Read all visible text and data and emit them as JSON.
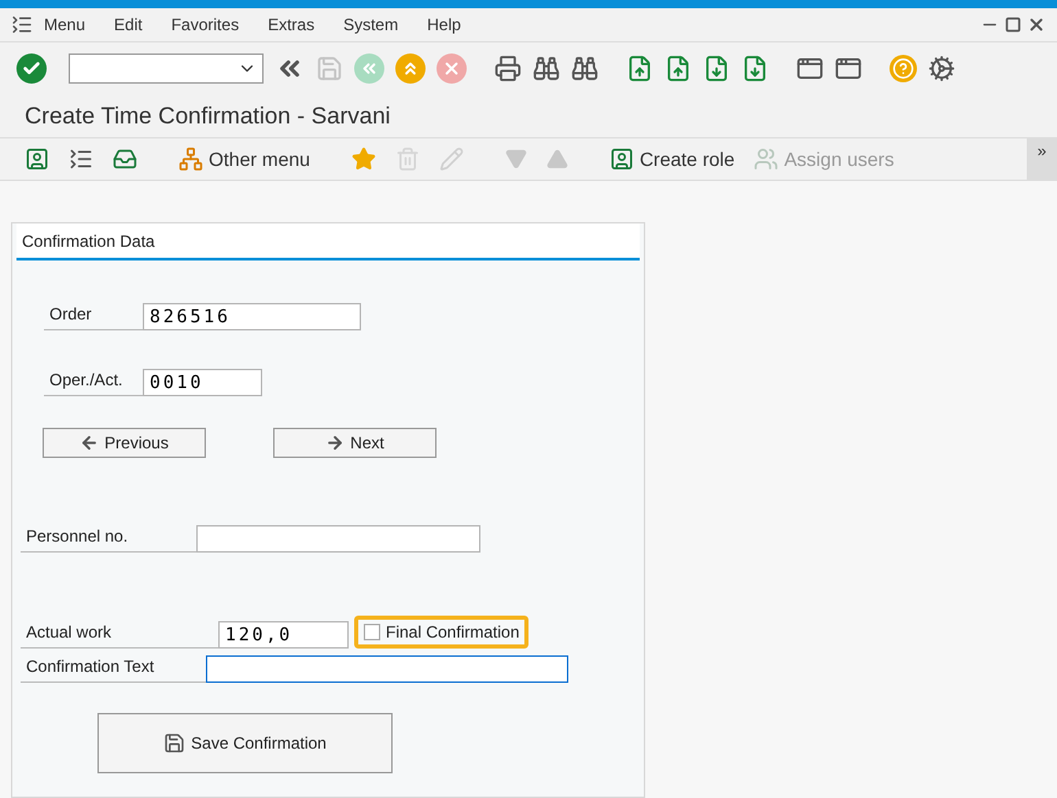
{
  "menu_bar": {
    "items": [
      "Menu",
      "Edit",
      "Favorites",
      "Extras",
      "System",
      "Help"
    ]
  },
  "toolbar": {
    "buttons": [
      {
        "kind": "enter",
        "disabled": false
      },
      {
        "kind": "collapse",
        "disabled": false
      },
      {
        "kind": "save",
        "disabled": true
      },
      {
        "kind": "back",
        "disabled": true
      },
      {
        "kind": "exit",
        "disabled": false
      },
      {
        "kind": "cancel",
        "disabled": true
      },
      {
        "kind": "print",
        "disabled": false
      },
      {
        "kind": "find",
        "disabled": false
      },
      {
        "kind": "find-next",
        "disabled": false
      },
      {
        "kind": "first-page",
        "disabled": false
      },
      {
        "kind": "previous-page",
        "disabled": false
      },
      {
        "kind": "next-page",
        "disabled": false
      },
      {
        "kind": "last-page",
        "disabled": false
      },
      {
        "kind": "new-session",
        "disabled": false
      },
      {
        "kind": "shortcut",
        "disabled": false
      },
      {
        "kind": "help",
        "disabled": false
      },
      {
        "kind": "settings",
        "disabled": false
      }
    ]
  },
  "screen_title": "Create Time Confirmation - Sarvani",
  "app_toolbar": {
    "items": [
      {
        "kind": "user-menu",
        "disabled": false
      },
      {
        "kind": "sap-menu",
        "disabled": false
      },
      {
        "kind": "download",
        "disabled": false
      },
      {
        "kind": "other-menu",
        "label": "Other menu",
        "disabled": false
      },
      {
        "kind": "add-favorite",
        "disabled": false
      },
      {
        "kind": "delete-favorite",
        "disabled": true
      },
      {
        "kind": "edit",
        "disabled": true
      },
      {
        "kind": "move-down",
        "disabled": true
      },
      {
        "kind": "move-up",
        "disabled": true
      },
      {
        "kind": "create-role",
        "label": "Create role",
        "disabled": false
      },
      {
        "kind": "assign-users",
        "label": "Assign users",
        "disabled": true
      }
    ],
    "overflow": "»"
  },
  "panel": {
    "title": "Confirmation Data",
    "order": {
      "label": "Order",
      "value": "826516"
    },
    "operation": {
      "label": "Oper./Act.",
      "value": "0010"
    },
    "previous_button": "Previous",
    "next_button": "Next",
    "personnel": {
      "label": "Personnel no."
    },
    "actual_work": {
      "label": "Actual work",
      "value": "120,0"
    },
    "final_confirmation": {
      "label": "Final Confirmation",
      "checked": false,
      "highlighted": true
    },
    "confirmation_text": {
      "label": "Confirmation Text",
      "focused": true
    },
    "save_button": "Save Confirmation"
  }
}
